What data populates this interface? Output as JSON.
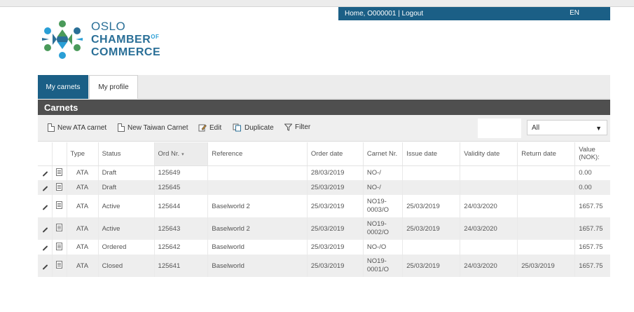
{
  "userbar": {
    "links": "Home, O000001 | Logout",
    "language": "EN"
  },
  "logo": {
    "line1": "OSLO",
    "line2": "CHAMBER",
    "line2_sup": "OF",
    "line3": "COMMERCE"
  },
  "tabs": [
    {
      "label": "My carnets",
      "active": true
    },
    {
      "label": "My profile",
      "active": false
    }
  ],
  "section_title": "Carnets",
  "toolbar": {
    "new_ata": "New ATA carnet",
    "new_taiwan": "New Taiwan Carnet",
    "edit": "Edit",
    "duplicate": "Duplicate",
    "filter": "Filter",
    "select_value": "All"
  },
  "table": {
    "headers": [
      "Type",
      "Status",
      "Ord Nr.",
      "Reference",
      "Order date",
      "Carnet Nr.",
      "Issue date",
      "Validity date",
      "Return date",
      "Value (NOK):"
    ],
    "sort_caret": "▾",
    "rows": [
      [
        "ATA",
        "Draft",
        "125649",
        "",
        "28/03/2019",
        "NO-/",
        "",
        "",
        "",
        "0.00"
      ],
      [
        "ATA",
        "Draft",
        "125645",
        "",
        "25/03/2019",
        "NO-/",
        "",
        "",
        "",
        "0.00"
      ],
      [
        "ATA",
        "Active",
        "125644",
        "Baselworld 2",
        "25/03/2019",
        "NO19-0003/O",
        "25/03/2019",
        "24/03/2020",
        "",
        "1657.75"
      ],
      [
        "ATA",
        "Active",
        "125643",
        "Baselworld 2",
        "25/03/2019",
        "NO19-0002/O",
        "25/03/2019",
        "24/03/2020",
        "",
        "1657.75"
      ],
      [
        "ATA",
        "Ordered",
        "125642",
        "Baselworld",
        "25/03/2019",
        "NO-/O",
        "",
        "",
        "",
        "1657.75"
      ],
      [
        "ATA",
        "Closed",
        "125641",
        "Baselworld",
        "25/03/2019",
        "NO19-0001/O",
        "25/03/2019",
        "24/03/2020",
        "25/03/2019",
        "1657.75"
      ]
    ]
  },
  "colors": {
    "brand_blue": "#1b5f86",
    "header_dark": "#4f4f4f",
    "logo_blue": "#2a6f97",
    "logo_green": "#4a9a5a"
  }
}
